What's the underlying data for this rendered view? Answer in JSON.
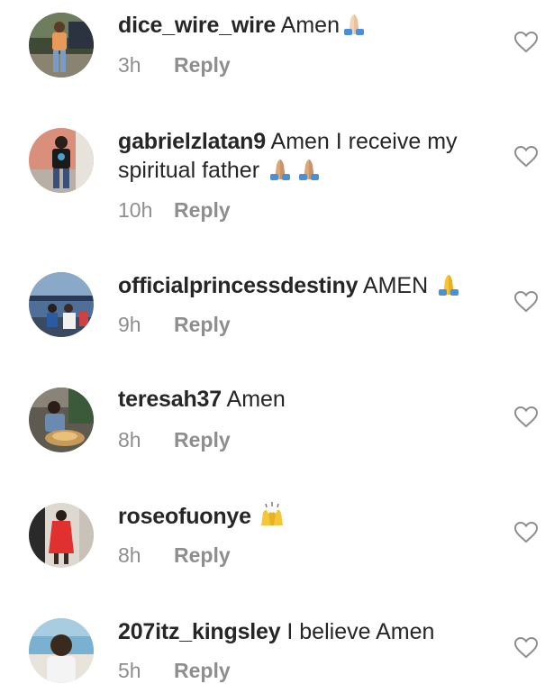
{
  "comments": [
    {
      "username": "dice_wire_wire",
      "text": "Amen",
      "emojis": [
        "folded-hands-light-icon"
      ],
      "time": "3h",
      "reply": "Reply",
      "avatar_bg": "#4a5a3a"
    },
    {
      "username": "gabrielzlatan9",
      "text": "Amen I receive my spiritual father",
      "emojis": [
        "folded-hands-medium-icon",
        "folded-hands-medium-icon"
      ],
      "time": "10h",
      "reply": "Reply",
      "avatar_bg": "#c98a7a"
    },
    {
      "username": "officialprincessdestiny",
      "text": "AMEN",
      "emojis": [
        "folded-hands-yellow-icon"
      ],
      "time": "9h",
      "reply": "Reply",
      "avatar_bg": "#5a7fae"
    },
    {
      "username": "teresah37",
      "text": "Amen",
      "emojis": [],
      "time": "8h",
      "reply": "Reply",
      "avatar_bg": "#6b5a48"
    },
    {
      "username": "roseofuonye",
      "text": "",
      "emojis": [
        "raising-hands-icon"
      ],
      "time": "8h",
      "reply": "Reply",
      "avatar_bg": "#d8d2c8"
    },
    {
      "username": "207itz_kingsley",
      "text": "I believe Amen",
      "emojis": [],
      "time": "5h",
      "reply": "Reply",
      "avatar_bg": "#6aa3c8"
    }
  ],
  "colors": {
    "text": "#262626",
    "meta": "#8e8e8e",
    "heart": "#8e8e8e"
  },
  "icons": {
    "like": "heart-outline-icon"
  }
}
